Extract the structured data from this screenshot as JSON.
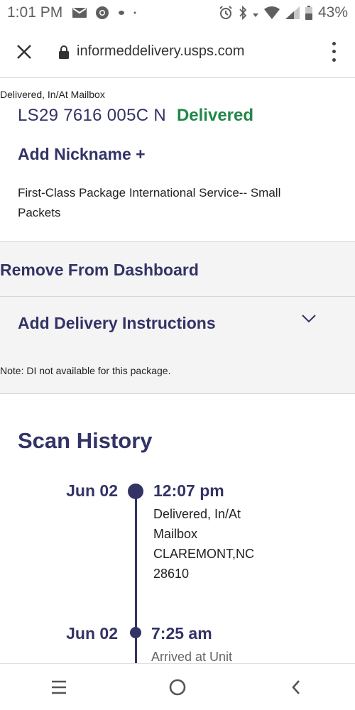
{
  "status_bar": {
    "time": "1:01 PM",
    "battery": "43%",
    "icons": [
      "mail-icon",
      "chrome-icon",
      "dot-icon",
      "small-dot-icon",
      "alarm-icon",
      "bluetooth-icon",
      "data-arrows-icon",
      "wifi-icon",
      "signal-icon",
      "battery-icon"
    ]
  },
  "browser": {
    "url": "informeddelivery.usps.com"
  },
  "package": {
    "status_small": "Delivered, In/At Mailbox",
    "tracking_number": "LS29 7616 005C N",
    "tracking_status": "Delivered",
    "add_nickname": "Add Nickname +",
    "service": "First-Class Package International Service-- Small Packets",
    "status_color": "#218748",
    "brand_color": "#333366"
  },
  "actions": {
    "remove": "Remove From Dashboard",
    "delivery_instructions": "Add Delivery Instructions",
    "di_note": "Note: DI not available for this package."
  },
  "scan_history": {
    "title": "Scan History",
    "events": [
      {
        "date": "Jun 02",
        "time": "12:07 pm",
        "lines": [
          "Delivered, In/At",
          "Mailbox",
          "CLAREMONT,NC",
          "28610"
        ]
      },
      {
        "date": "Jun 02",
        "time": "7:25 am",
        "lines": [
          "Arrived at Unit"
        ]
      }
    ]
  },
  "nav": {
    "icons": [
      "recent-apps-icon",
      "home-icon",
      "back-icon"
    ]
  }
}
